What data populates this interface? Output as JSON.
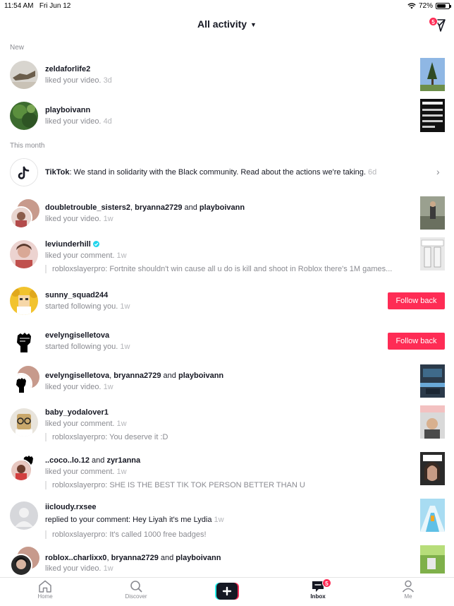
{
  "status_bar": {
    "time": "11:54 AM",
    "date": "Fri Jun 12",
    "battery": "72%",
    "battery_level": 0.72
  },
  "header": {
    "title": "All activity",
    "messages_badge": "5"
  },
  "sections": {
    "new": "New",
    "this_month": "This month"
  },
  "notifications": [
    {
      "user": "zeldaforlife2",
      "action": "liked your video.",
      "ago": "3d"
    },
    {
      "user": "playboivann",
      "action": "liked your video.",
      "ago": "4d"
    },
    {
      "user": "TikTok",
      "message": ": We stand in solidarity with the Black community. Read about the actions we're taking.",
      "ago": "6d"
    },
    {
      "users": [
        "doubletrouble_sisters2",
        "bryanna2729",
        "playboivann"
      ],
      "separator": ", ",
      "conjunction": " and ",
      "action": "liked your video.",
      "ago": "1w"
    },
    {
      "user": "leviunderhill",
      "verified": true,
      "action": "liked your comment.",
      "ago": "1w",
      "quote": "robloxslayerpro: Fortnite shouldn't win cause all u do is kill and shoot in Roblox there's 1M games..."
    },
    {
      "user": "sunny_squad244",
      "action": "started following you.",
      "ago": "1w",
      "button": "Follow back"
    },
    {
      "user": "evelyngiselletova",
      "action": "started following you.",
      "ago": "1w",
      "button": "Follow back"
    },
    {
      "users": [
        "evelyngiselletova",
        "bryanna2729",
        "playboivann"
      ],
      "separator": ", ",
      "conjunction": " and ",
      "action": "liked your video.",
      "ago": "1w"
    },
    {
      "user": "baby_yodalover1",
      "action": "liked your comment.",
      "ago": "1w",
      "quote": "robloxslayerpro: You deserve it :D"
    },
    {
      "users": [
        "..coco..lo.12",
        "zyr1anna"
      ],
      "conjunction": " and ",
      "action": "liked your comment.",
      "ago": "1w",
      "quote": "robloxslayerpro: SHE IS THE BEST TIK TOK PERSON BETTER THAN U"
    },
    {
      "user": "iicloudy.rxsee",
      "action": "replied to your comment: Hey Liyah it's me Lydia",
      "ago": "1w",
      "quote": "robloxslayerpro: It's called 1000 free badges!"
    },
    {
      "users": [
        "roblox..charlixx0",
        "bryanna2729",
        "playboivann"
      ],
      "separator": ", ",
      "conjunction": " and ",
      "action": "liked your video.",
      "ago": "1w"
    }
  ],
  "tabbar": {
    "home": "Home",
    "discover": "Discover",
    "inbox": "Inbox",
    "inbox_badge": "5",
    "me": "Me"
  },
  "colors": {
    "accent": "#fe2c55",
    "verified": "#20d5ec",
    "muted": "#8a8b91"
  },
  "icons": [
    "wifi-icon",
    "send-icon",
    "tiktok-logo-icon",
    "chevron-right-icon",
    "verified-icon",
    "home-icon",
    "search-icon",
    "create-plus-icon",
    "inbox-icon",
    "profile-icon"
  ]
}
